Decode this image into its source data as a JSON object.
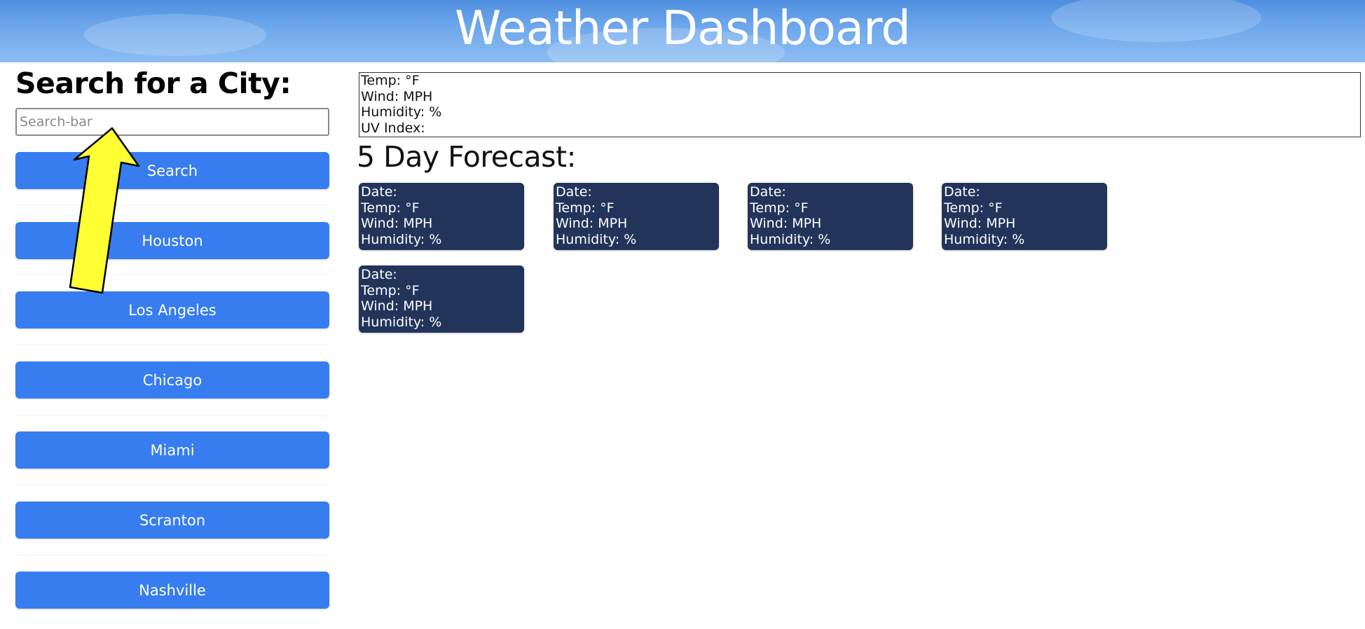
{
  "header": {
    "title": "Weather Dashboard"
  },
  "sidebar": {
    "heading": "Search for a City:",
    "search_placeholder": "Search-bar",
    "search_button_label": "Search",
    "cities": [
      "Houston",
      "Los Angeles",
      "Chicago",
      "Miami",
      "Scranton",
      "Nashville"
    ]
  },
  "current": {
    "temp": "Temp: °F",
    "wind": "Wind: MPH",
    "humidity": "Humidity: %",
    "uv_index": "UV Index:"
  },
  "forecast": {
    "heading": "5 Day Forecast:",
    "cards": [
      {
        "date": "Date:",
        "temp": "Temp: °F",
        "wind": "Wind: MPH",
        "humidity": "Humidity: %"
      },
      {
        "date": "Date:",
        "temp": "Temp: °F",
        "wind": "Wind: MPH",
        "humidity": "Humidity: %"
      },
      {
        "date": "Date:",
        "temp": "Temp: °F",
        "wind": "Wind: MPH",
        "humidity": "Humidity: %"
      },
      {
        "date": "Date:",
        "temp": "Temp: °F",
        "wind": "Wind: MPH",
        "humidity": "Humidity: %"
      },
      {
        "date": "Date:",
        "temp": "Temp: °F",
        "wind": "Wind: MPH",
        "humidity": "Humidity: %"
      }
    ]
  },
  "colors": {
    "button": "#377df0",
    "card": "#22345a",
    "header_top": "#4f8fe0",
    "arrow_fill": "#ffff33"
  }
}
